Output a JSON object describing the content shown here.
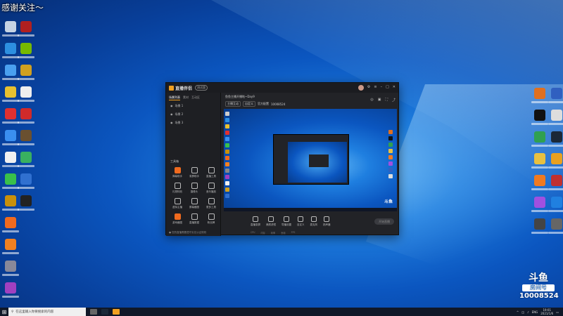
{
  "watermark": "感谢关注～",
  "app": {
    "title": "直播伴侣",
    "beta": "测试版",
    "left_tabs": [
      "场景列表",
      "素材",
      "互动区"
    ],
    "scenes": [
      "场景 1",
      "场景 2",
      "场景 3"
    ],
    "tools_title": "工具箱",
    "tools": [
      "弹幕助手",
      "录屏助手",
      "直播工具",
      "礼物特效",
      "摄像头",
      "音乐播放",
      "虚拟主播",
      "屏幕截图",
      "更多工具",
      "游戏截图",
      "直播数据",
      "粉丝牌"
    ],
    "notice": "● 您的直播需要遵守实名认证规则",
    "stream_title": "鱼鱼主播开播啦~Day9",
    "room_no": "10008524",
    "stage_tags": [
      "主播互动",
      "自定义",
      "官方配置"
    ],
    "controls": [
      "直播录屏",
      "美颜滤镜",
      "导播设置",
      "自定义",
      "麦克风",
      "扬声器"
    ],
    "live_button": "开始直播",
    "status": [
      "CPU",
      "内存",
      "码率",
      "丢帧",
      "FPS"
    ]
  },
  "douyu": {
    "logo": "斗鱼",
    "label": "房间号",
    "room_number": "10008524"
  },
  "taskbar": {
    "search_placeholder": "在这里输入你要搜索的内容",
    "time": "19:01",
    "date": "2021/1/6",
    "lang": "ENG"
  },
  "colors": {
    "accent": "#f06a1e",
    "desktop": "#0b56c0",
    "taskbar": "#101828"
  }
}
